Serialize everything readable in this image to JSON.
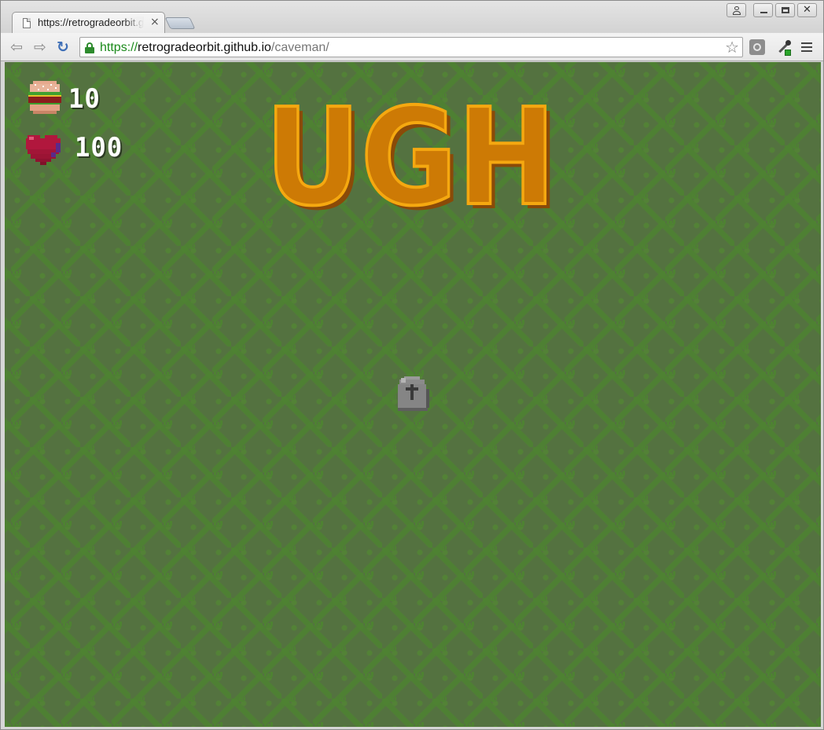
{
  "browser": {
    "tab": {
      "title": "https://retrogradeorbit.github.io/caveman/",
      "close_glyph": "×"
    },
    "address": {
      "scheme": "https://",
      "host": "retrogradeorbit.github.io",
      "path": "/caveman/"
    },
    "icons": {
      "back": "back-arrow-icon",
      "forward": "forward-arrow-icon",
      "reload": "reload-icon",
      "lock": "lock-icon",
      "bookmark": "star-icon",
      "extension": "extension-icon",
      "eyedropper": "eyedropper-icon",
      "menu": "hamburger-menu-icon"
    }
  },
  "game": {
    "logo_text": "UGH",
    "hud": {
      "food": {
        "icon": "burger-icon",
        "value": "10"
      },
      "health": {
        "icon": "heart-icon",
        "value": "100"
      }
    },
    "objects": [
      {
        "type": "gravestone",
        "icon": "gravestone-icon"
      }
    ],
    "colors": {
      "grass": "#547240",
      "grass_detail": "#4e8232",
      "logo_fill": "#cd7a05",
      "logo_highlight": "#f5a810",
      "logo_shadow": "#8a4a08",
      "hud_text": "#ffffff"
    }
  }
}
